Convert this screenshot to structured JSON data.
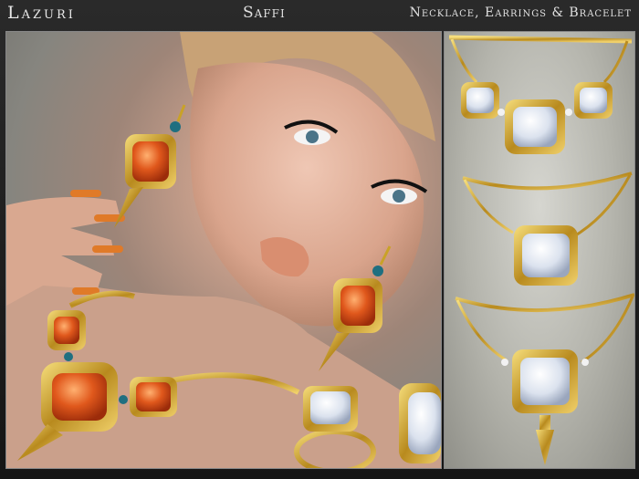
{
  "header": {
    "brand": "Lazuri",
    "product_name": "Saffi",
    "subtitle": "Necklace, Earrings & Bracelet"
  },
  "colors": {
    "gold": "#c9a227",
    "gem_orange": "#d4541c",
    "gem_moonstone": "#dfe6ef",
    "bead_teal": "#1f6f80"
  },
  "images": {
    "model_photo": "model-wearing-saffi-jewelry",
    "variants": [
      "necklace-three-stone",
      "necklace-single-stone",
      "necklace-single-stone-with-spike"
    ]
  }
}
